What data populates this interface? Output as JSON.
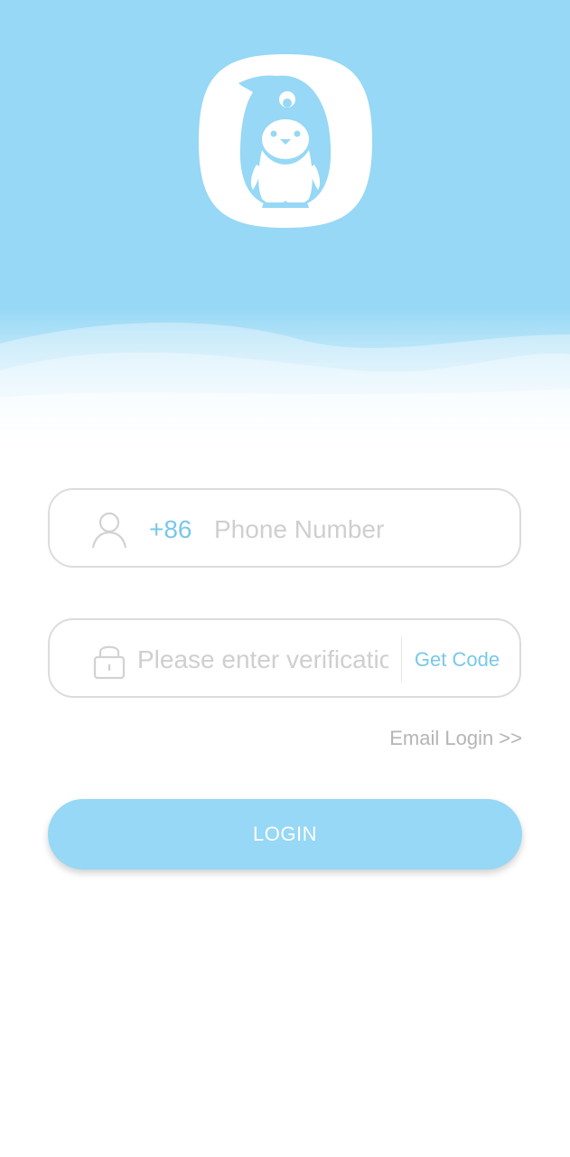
{
  "theme": {
    "accent": "#96d8f5",
    "accent_text": "#78c8ea",
    "placeholder": "#cfcfcf",
    "border": "#dcdcdc"
  },
  "logo": {
    "icon": "penguin-logo-icon"
  },
  "phone_field": {
    "icon": "user-icon",
    "country_code": "+86",
    "placeholder": "Phone Number",
    "value": ""
  },
  "code_field": {
    "icon": "lock-icon",
    "placeholder": "Please enter verification code",
    "value": "",
    "get_code_label": "Get Code"
  },
  "email_login_label": "Email Login >>",
  "login_button_label": "LOGIN"
}
